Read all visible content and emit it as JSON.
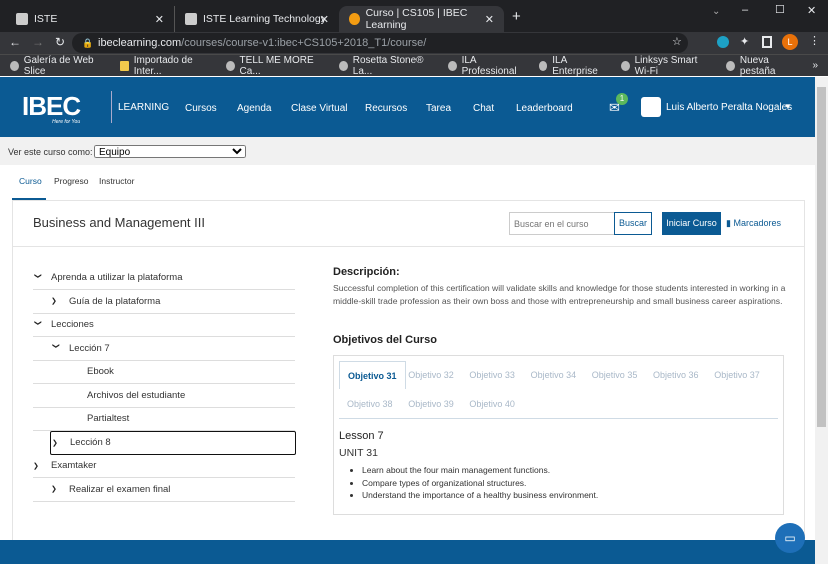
{
  "browser": {
    "tabs": [
      {
        "title": "ISTE"
      },
      {
        "title": "ISTE Learning Technology Directo"
      },
      {
        "title": "Curso | CS105 | IBEC Learning"
      }
    ],
    "url_domain": "ibeclearning.com",
    "url_path": "/courses/course-v1:ibec+CS105+2018_T1/course/",
    "bookmarks": [
      "Galería de Web Slice",
      "Importado de Inter...",
      "TELL ME MORE Ca...",
      "Rosetta Stone® La...",
      "ILA Professional",
      "ILA Enterprise",
      "Linksys Smart Wi-Fi",
      "Nueva pestaña"
    ],
    "profile_initial": "L"
  },
  "header": {
    "logo": "IBEC",
    "logo_tag": "Here for You",
    "learning": "LEARNING",
    "nav": [
      "Cursos",
      "Agenda",
      "Clase Virtual",
      "Recursos",
      "Tarea",
      "Chat",
      "Leaderboard"
    ],
    "mail_badge": "1",
    "user": "Luis Alberto Peralta Nogales"
  },
  "view_as": {
    "label": "Ver este curso como:",
    "value": "Equipo"
  },
  "course_tabs": [
    "Curso",
    "Progreso",
    "Instructor"
  ],
  "course": {
    "title": "Business and Management III",
    "search_placeholder": "Buscar en el curso",
    "search_button": "Buscar",
    "start_button": "Iniciar Curso",
    "bookmarks": "Marcadores"
  },
  "outline": [
    {
      "label": "Aprenda a utilizar la plataforma",
      "level": 0,
      "chev": "⌄"
    },
    {
      "label": "Guía de la plataforma",
      "level": 1,
      "chev": "›"
    },
    {
      "label": "Lecciones",
      "level": 0,
      "chev": "⌄"
    },
    {
      "label": "Lección 7",
      "level": 1,
      "chev": "⌄"
    },
    {
      "label": "Ebook",
      "level": 2,
      "chev": ""
    },
    {
      "label": "Archivos del estudiante",
      "level": 2,
      "chev": ""
    },
    {
      "label": "Partialtest",
      "level": 2,
      "chev": ""
    },
    {
      "label": "Lección 8",
      "level": 1,
      "chev": "›"
    },
    {
      "label": "Examtaker",
      "level": 0,
      "chev": "›"
    },
    {
      "label": "Realizar el examen final",
      "level": 1,
      "chev": "›"
    }
  ],
  "description": {
    "heading": "Descripción:",
    "text": "Successful completion of this certification will validate skills and knowledge for those students interested in working in a middle-skill trade profession as their own boss and those with entrepreneurship and small business career aspirations."
  },
  "objectives": {
    "heading": "Objetivos del Curso",
    "tabs": [
      "Objetivo 31",
      "Objetivo 32",
      "Objetivo 33",
      "Objetivo 34",
      "Objetivo 35",
      "Objetivo 36",
      "Objetivo 37",
      "Objetivo 38",
      "Objetivo 39",
      "Objetivo 40"
    ],
    "lesson": "Lesson 7",
    "unit": "UNIT 31",
    "items": [
      "Learn about the four main management functions.",
      "Compare types of organizational structures.",
      "Understand the importance of a healthy business environment."
    ]
  }
}
